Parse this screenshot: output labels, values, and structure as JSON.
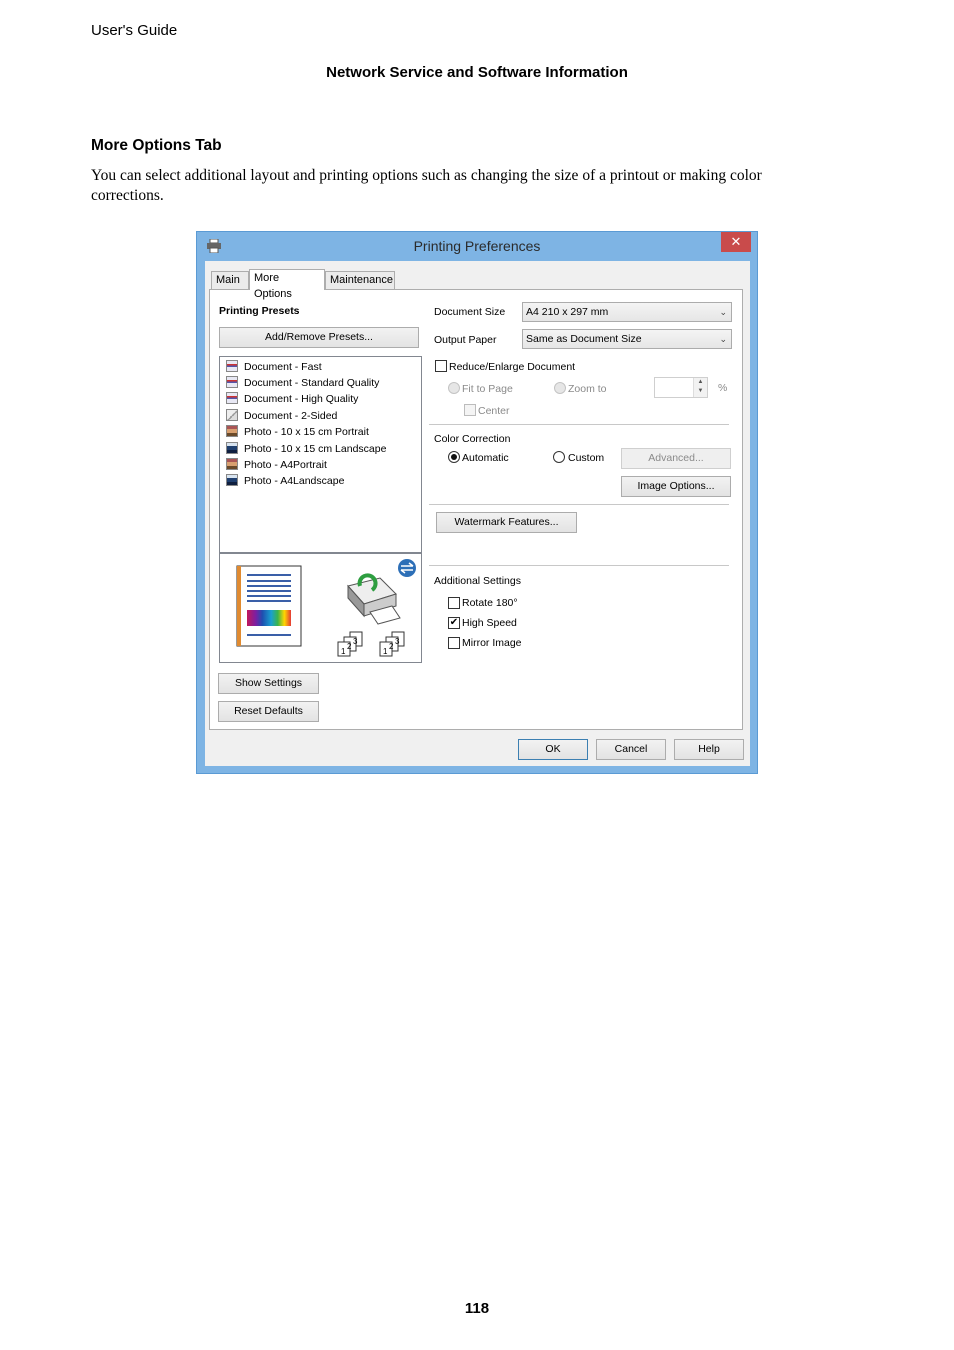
{
  "page": {
    "running_head": "User's Guide",
    "chapter_title": "Network Service and Software Information",
    "section_title": "More Options Tab",
    "body_text": "You can select additional layout and printing options such as changing the size of a printout or making color corrections.",
    "page_number": "118"
  },
  "dialog": {
    "title": "Printing Preferences",
    "title_icon": "printer-icon",
    "close_label": "✕",
    "tabs": [
      {
        "label": "Main",
        "active": false
      },
      {
        "label": "More Options",
        "active": true
      },
      {
        "label": "Maintenance",
        "active": false
      }
    ],
    "presets": {
      "heading": "Printing Presets",
      "add_remove_label": "Add/Remove Presets...",
      "items": [
        {
          "label": "Document - Fast",
          "icon": "document-icon"
        },
        {
          "label": "Document - Standard Quality",
          "icon": "document-icon"
        },
        {
          "label": "Document - High Quality",
          "icon": "document-icon"
        },
        {
          "label": "Document - 2-Sided",
          "icon": "two-sided-document-icon"
        },
        {
          "label": "Photo - 10 x 15 cm Portrait",
          "icon": "photo-portrait-icon"
        },
        {
          "label": "Photo - 10 x 15 cm Landscape",
          "icon": "photo-landscape-icon"
        },
        {
          "label": "Photo - A4Portrait",
          "icon": "photo-portrait-icon"
        },
        {
          "label": "Photo - A4Landscape",
          "icon": "photo-landscape-icon"
        }
      ]
    },
    "preview": {
      "collate_labels": [
        "1",
        "2",
        "3"
      ]
    },
    "show_settings_label": "Show Settings",
    "reset_defaults_label": "Reset Defaults",
    "document_size": {
      "label": "Document Size",
      "value": "A4 210 x 297 mm"
    },
    "output_paper": {
      "label": "Output Paper",
      "value": "Same as Document Size"
    },
    "reduce_enlarge": {
      "label": "Reduce/Enlarge Document",
      "checked": false,
      "fit_to_page_label": "Fit to Page",
      "zoom_to_label": "Zoom to",
      "zoom_value": "",
      "percent_label": "%",
      "center_label": "Center"
    },
    "color_correction": {
      "heading": "Color Correction",
      "automatic_label": "Automatic",
      "custom_label": "Custom",
      "selected": "Automatic",
      "advanced_label": "Advanced...",
      "image_options_label": "Image Options..."
    },
    "watermark_label": "Watermark Features...",
    "additional_settings": {
      "heading": "Additional Settings",
      "items": [
        {
          "label": "Rotate 180°",
          "checked": false
        },
        {
          "label": "High Speed",
          "checked": true
        },
        {
          "label": "Mirror Image",
          "checked": false
        }
      ]
    },
    "footer": {
      "ok_label": "OK",
      "cancel_label": "Cancel",
      "help_label": "Help"
    },
    "colors": {
      "frame": "#7eb4e4",
      "close": "#c94b4b",
      "client": "#f0f0f0"
    }
  }
}
